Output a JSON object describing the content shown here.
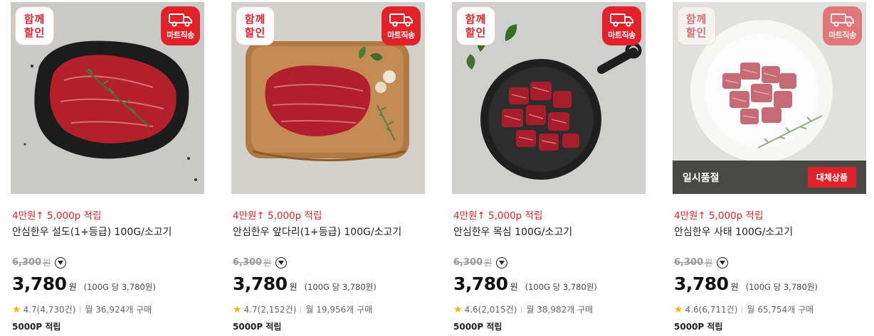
{
  "labels": {
    "together_badge": "함께\n할인",
    "mart_badge": "마트직송",
    "soldout": "일시품절",
    "alternative": "대체상품",
    "won": "원"
  },
  "products": [
    {
      "promo": "4만원↑ 5,000p 적립",
      "name": "안심한우 설도(1+등급) 100G/소고기",
      "original_price": "6,300",
      "original_unit": "원",
      "price": "3,780",
      "unit_price": "(100G 당 3,780원)",
      "rating": "4.7",
      "reviews": "(4,730건)",
      "monthly": "월 36,924개 구매",
      "points": "5000P 적립",
      "soldout": false
    },
    {
      "promo": "4만원↑ 5,000p 적립",
      "name": "안심한우 앞다리(1+등급) 100G/소고기",
      "original_price": "6,300",
      "original_unit": "원",
      "price": "3,780",
      "unit_price": "(100G 당 3,780원)",
      "rating": "4.7",
      "reviews": "(2,152건)",
      "monthly": "월 19,956개 구매",
      "points": "5000P 적립",
      "soldout": false
    },
    {
      "promo": "4만원↑ 5,000p 적립",
      "name": "안심한우 목심 100G/소고기",
      "original_price": "6,300",
      "original_unit": "원",
      "price": "3,780",
      "unit_price": "(100G 당 3,780원)",
      "rating": "4.6",
      "reviews": "(2,015건)",
      "monthly": "월 38,982개 구매",
      "points": "5000P 적립",
      "soldout": false
    },
    {
      "promo": "4만원↑ 5,000p 적립",
      "name": "안심한우 사태 100G/소고기",
      "original_price": "6,300",
      "original_unit": "원",
      "price": "3,780",
      "unit_price": "(100G 당 3,780원)",
      "rating": "4.6",
      "reviews": "(6,711건)",
      "monthly": "월 65,754개 구매",
      "points": "5000P 적립",
      "soldout": true
    }
  ],
  "colors": {
    "accent": "#e2212a",
    "star": "#f5b800"
  },
  "icons": {
    "truck": "truck-icon",
    "star": "star-icon",
    "chevron": "chevron-down-icon"
  }
}
